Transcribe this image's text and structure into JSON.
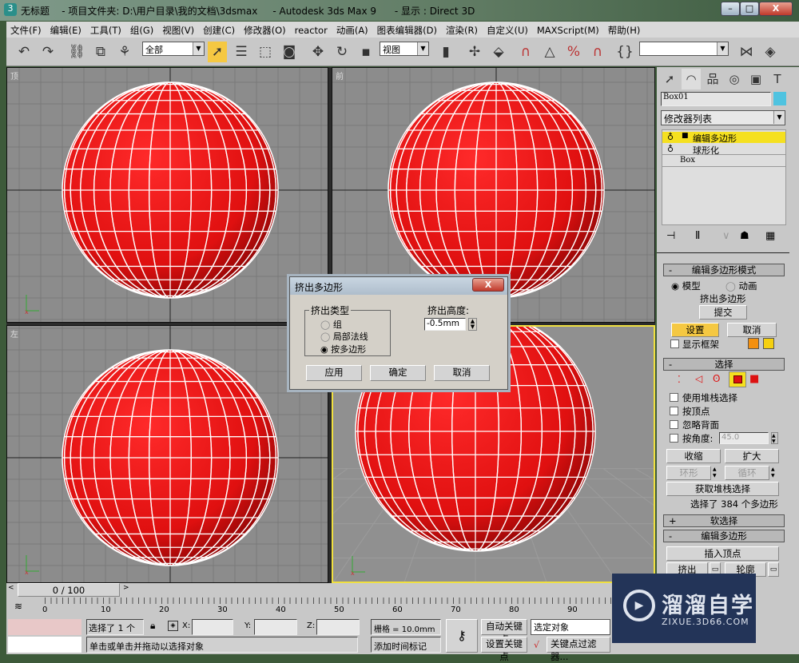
{
  "window": {
    "title": "无标题    - 项目文件夹: D:\\用户目录\\我的文档\\3dsmax     - Autodesk 3ds Max 9      - 显示 : Direct 3D",
    "minimize": "–",
    "maximize": "□",
    "close": "X"
  },
  "menu": [
    "文件(F)",
    "编辑(E)",
    "工具(T)",
    "组(G)",
    "视图(V)",
    "创建(C)",
    "修改器(O)",
    "reactor",
    "动画(A)",
    "图表编辑器(D)",
    "渲染(R)",
    "自定义(U)",
    "MAXScript(M)",
    "帮助(H)"
  ],
  "toolbar": {
    "selection_filter": "全部",
    "reference_coord": "视图",
    "named_selection": ""
  },
  "viewports": [
    {
      "label": "顶"
    },
    {
      "label": "前"
    },
    {
      "label": "左"
    },
    {
      "label": ""
    }
  ],
  "colors": {
    "sphere": "#e01010",
    "wire": "#ffffff",
    "active_viewport": "#f0e040",
    "object_color": "#4fc3e0",
    "accent_yellow": "#f5e020"
  },
  "panel": {
    "object_name": "Box01",
    "modifier_list": "修改器列表",
    "stack": [
      "编辑多边形",
      "球形化",
      "Box"
    ],
    "edit_poly_mode": {
      "title": "编辑多边形模式",
      "model": "模型",
      "animate": "动画",
      "current_op": "挤出多边形",
      "commit": "提交",
      "settings": "设置",
      "cancel": "取消",
      "show_cage": "显示框架"
    },
    "selection": {
      "title": "选择",
      "use_stack": "使用堆栈选择",
      "by_vertex": "按顶点",
      "ignore_backface": "忽略背面",
      "by_angle": "按角度:",
      "angle_value": "45.0",
      "shrink": "收缩",
      "grow": "扩大",
      "ring": "环形",
      "loop": "循环",
      "get_stack": "获取堆栈选择",
      "status": "选择了 384 个多边形"
    },
    "soft_selection": {
      "title": "软选择"
    },
    "edit_polygons": {
      "title": "编辑多边形",
      "insert_vertex": "插入顶点",
      "extrude": "挤出",
      "outline": "轮廓"
    }
  },
  "dialog": {
    "title": "挤出多边形",
    "close": "X",
    "group_label": "挤出类型",
    "options": [
      "组",
      "局部法线",
      "按多边形"
    ],
    "selected": "按多边形",
    "height_label": "挤出高度:",
    "height_value": "-0.5mm",
    "apply": "应用",
    "ok": "确定",
    "cancel": "取消"
  },
  "timeline": {
    "frame": "0 / 100",
    "ticks": [
      "0",
      "10",
      "20",
      "30",
      "40",
      "50",
      "60",
      "70",
      "80",
      "90"
    ]
  },
  "status": {
    "selected": "选择了 1 个",
    "x_label": "X:",
    "y_label": "Y:",
    "z_label": "Z:",
    "grid": "栅格 = 10.0mm",
    "prompt": "单击或单击并拖动以选择对象",
    "add_time_tag": "添加时间标记",
    "auto_key": "自动关键点",
    "set_key": "设置关键点",
    "key_mode": "选定对象",
    "key_filters": "关键点过滤器..."
  },
  "watermark": {
    "brand": "溜溜自学",
    "url": "ZIXUE.3D66.COM"
  }
}
